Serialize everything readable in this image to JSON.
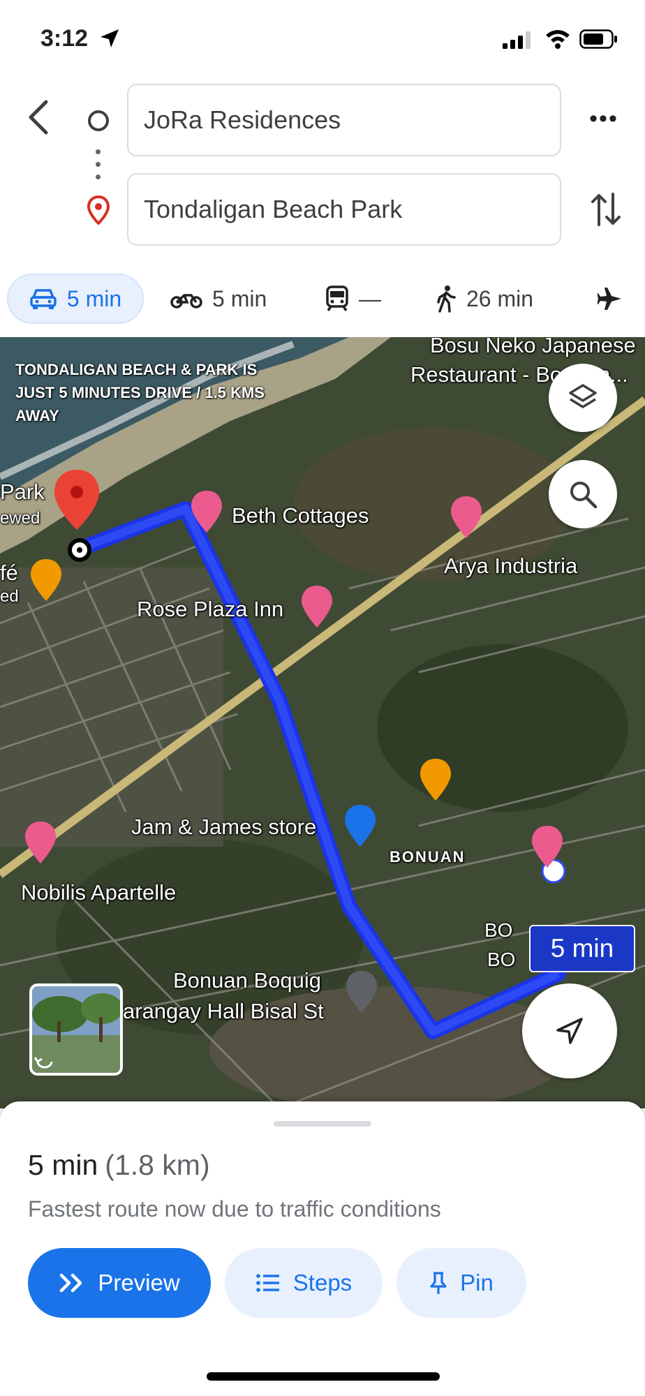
{
  "status_bar": {
    "time": "3:12"
  },
  "directions": {
    "origin": "JoRa Residences",
    "destination": "Tondaligan Beach Park"
  },
  "modes": [
    {
      "name": "drive",
      "icon": "car-icon",
      "label": "5 min",
      "selected": true
    },
    {
      "name": "motorcycle",
      "icon": "motorcycle-icon",
      "label": "5 min"
    },
    {
      "name": "transit",
      "icon": "train-icon",
      "label": "—"
    },
    {
      "name": "walk",
      "icon": "walk-icon",
      "label": "26 min"
    },
    {
      "name": "flight",
      "icon": "airplane-icon",
      "label": ""
    }
  ],
  "map": {
    "overlay_note": "TONDALIGAN BEACH & PARK IS JUST 5 MINUTES DRIVE / 1.5 KMS AWAY",
    "labels": {
      "bosu_neko_1": "Bosu Neko Japanese",
      "bosu_neko_2": "Restaurant - Bonuan...",
      "park": "Park",
      "reviewed": "ewed",
      "cafe": "fé",
      "cafe_sub": "ed",
      "beth_cottages": "Beth Cottages",
      "arya_industria": "Arya Industria",
      "rose_plaza_inn": "Rose Plaza Inn",
      "jam_james": "Jam & James store",
      "bonuan": "BONUAN",
      "nobilis": "Nobilis Apartelle",
      "bonuan_hall_1": "Bonuan Boquig",
      "bonuan_hall_2": "arangay Hall Bisal St",
      "bo1": "BO",
      "bo2": "BO"
    },
    "route_time_badge": "5 min",
    "route_color": "#1a34e8"
  },
  "sheet": {
    "duration": "5 min",
    "distance": "(1.8 km)",
    "subtitle": "Fastest route now due to traffic conditions",
    "buttons": {
      "preview": "Preview",
      "steps": "Steps",
      "pin": "Pin"
    }
  },
  "colors": {
    "accent": "#1a73e8",
    "accent_light": "#e8f0fe",
    "pin_red": "#ea4335",
    "hotel_pink": "#ec5b8d",
    "food_orange": "#f29900"
  }
}
